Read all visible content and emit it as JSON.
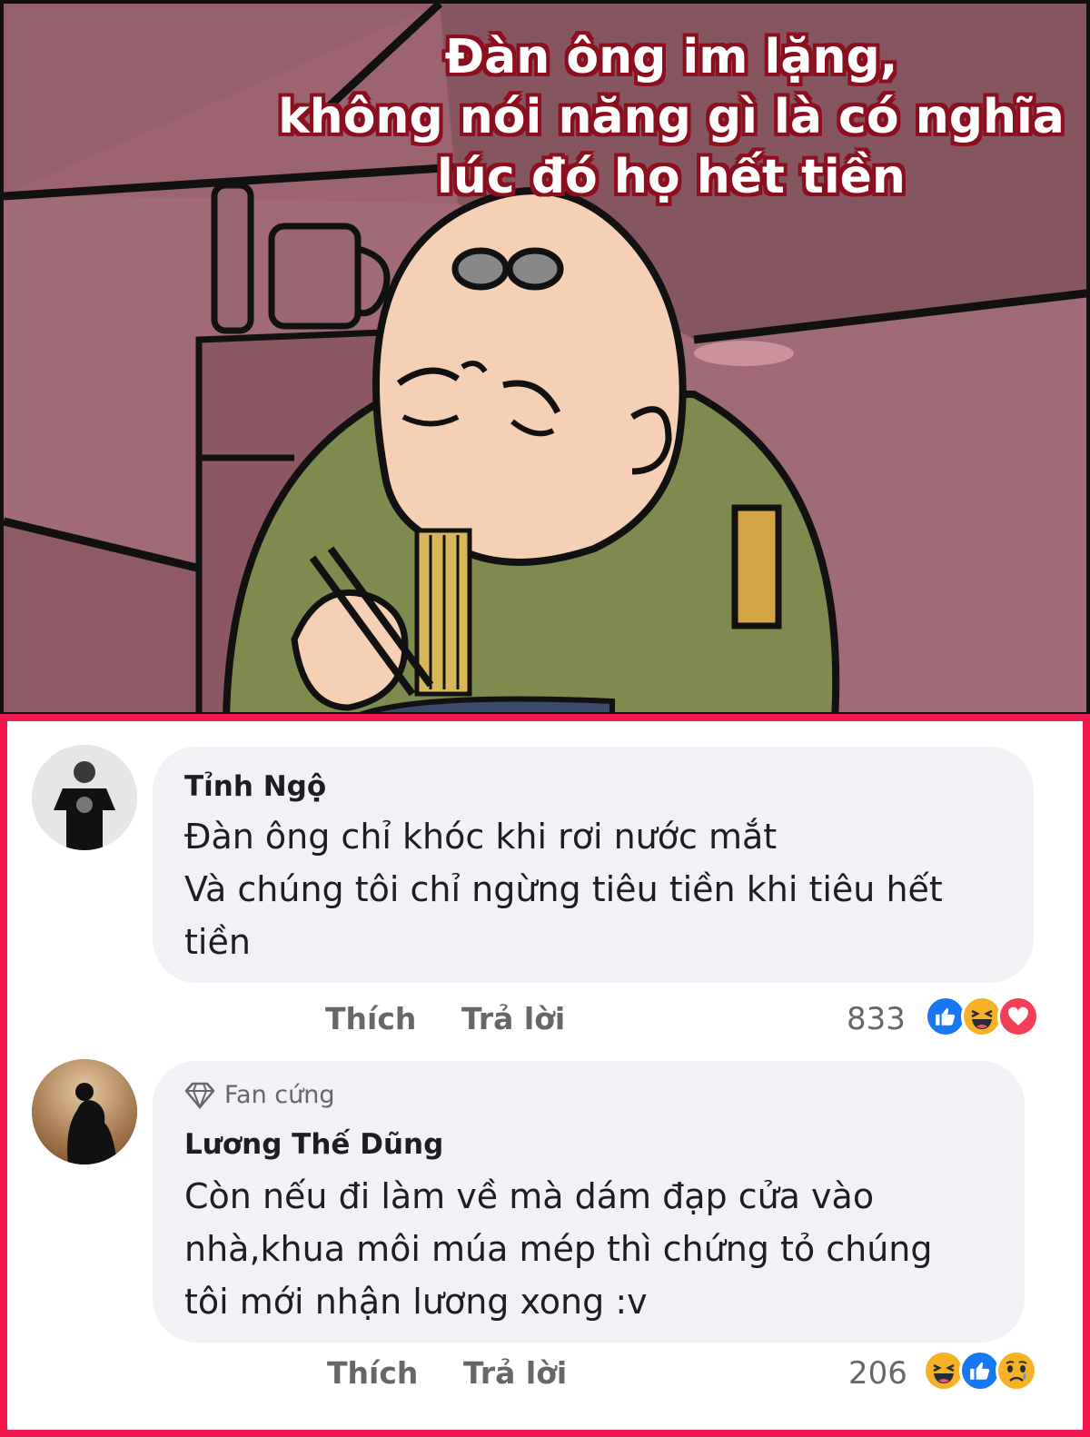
{
  "meme": {
    "caption_lines": [
      "Đàn ông im lặng,",
      "không nói năng gì là có nghĩa",
      "lúc đó họ hết tiền"
    ]
  },
  "comments": [
    {
      "author": "Tỉnh Ngộ",
      "text_lines": [
        "Đàn ông chỉ khóc khi rơi nước mắt",
        "Và chúng tôi chỉ ngừng tiêu tiền khi tiêu hết",
        "tiền"
      ],
      "like_label": "Thích",
      "reply_label": "Trả lời",
      "reaction_count": "833",
      "reactions": [
        "like-icon",
        "haha-icon",
        "love-icon"
      ]
    },
    {
      "badge": "Fan cứng",
      "author": "Lương Thế Dũng",
      "text_lines": [
        "Còn nếu đi làm về mà dám đạp cửa vào",
        "nhà,khua môi múa mép thì chứng tỏ chúng",
        "tôi mới nhận lương xong :v"
      ],
      "like_label": "Thích",
      "reply_label": "Trả lời",
      "reaction_count": "206",
      "reactions": [
        "haha-icon",
        "like-icon",
        "sad-icon"
      ]
    }
  ],
  "colors": {
    "frame_accent": "#f0194f",
    "bubble_bg": "#f0f2f5",
    "caption_outline": "#8b0f1f",
    "wall": "#9c6470"
  }
}
